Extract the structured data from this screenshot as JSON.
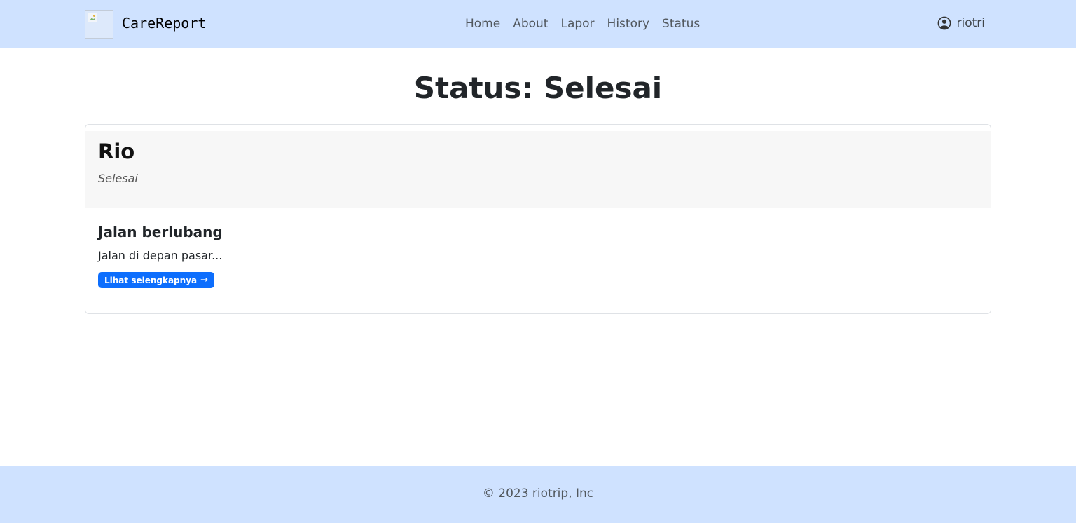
{
  "navbar": {
    "brand": {
      "name": "CareReport",
      "logo_icon": "broken-image-icon"
    },
    "links": [
      {
        "label": "Home"
      },
      {
        "label": "About"
      },
      {
        "label": "Lapor"
      },
      {
        "label": "History"
      },
      {
        "label": "Status"
      }
    ],
    "user": {
      "icon": "user-circle-icon",
      "name": "riotri"
    },
    "background_color": "#cfe2ff"
  },
  "main": {
    "title": "Status: Selesai",
    "report_card": {
      "reporter": "Rio",
      "status": "Selesai",
      "report_title": "Jalan berlubang",
      "excerpt": "Jalan di depan pasar...",
      "more_button": {
        "label": "Lihat selengkapnya",
        "icon": "arrow-right-icon",
        "color": "#0d6efd"
      }
    }
  },
  "footer": {
    "text": "© 2023 riotrip, Inc",
    "background_color": "#cfe2ff"
  }
}
